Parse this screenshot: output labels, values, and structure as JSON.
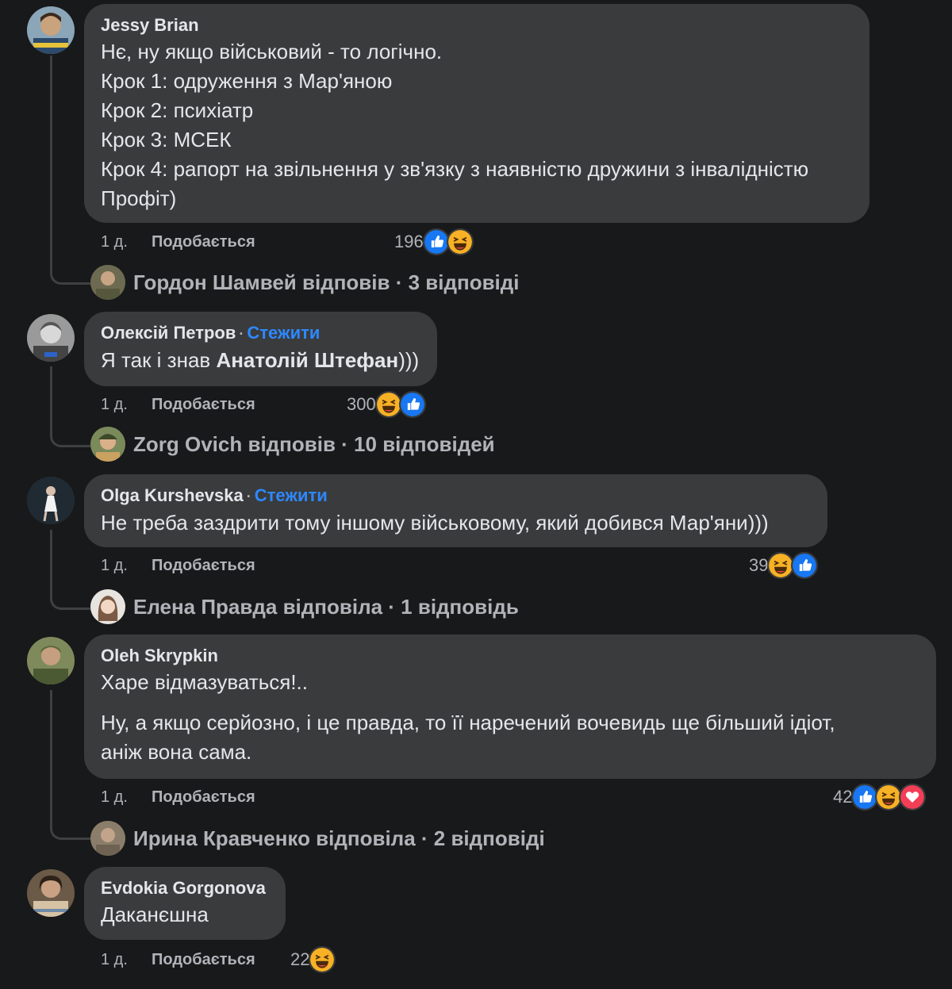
{
  "comments": [
    {
      "author": "Jessy Brian",
      "follow": "",
      "lines": [
        "Нє, ну якщо військовий - то логічно.",
        "Крок 1: одруження з Мар'яною",
        "Крок 2: психіатр",
        "Крок 3: МСЕК",
        "Крок 4: рапорт на звільнення у зв'язку з наявністю дружини з інвалідністю",
        "Профіт)"
      ],
      "time": "1 д.",
      "like_label": "Подобається",
      "reaction_count": "196",
      "reactions": [
        "like-icon",
        "haha-icon"
      ],
      "replies_text": "Гордон Шамвей відповів · 3 відповіді"
    },
    {
      "author": "Олексій Петров",
      "follow": "Стежити",
      "line_prefix": "Я так і знав ",
      "line_bold": "Анатолій Штефан",
      "line_suffix": ")))",
      "time": "1 д.",
      "like_label": "Подобається",
      "reaction_count": "300",
      "reactions": [
        "haha-icon",
        "like-icon"
      ],
      "replies_text": "Zorg Ovich відповів · 10 відповідей"
    },
    {
      "author": "Olga Kurshevska",
      "follow": "Стежити",
      "lines": [
        "Не треба заздрити тому іншому військовому, який добився Мар'яни)))"
      ],
      "time": "1 д.",
      "like_label": "Подобається",
      "reaction_count": "39",
      "reactions": [
        "haha-icon",
        "like-icon"
      ],
      "replies_text": "Елена Правда відповіла · 1 відповідь"
    },
    {
      "author": "Oleh Skrypkin",
      "follow": "",
      "lines": [
        "Харе відмазуваться!..",
        "Ну, а якщо серйозно, і це правда, то її наречений вочевидь ще більший ідіот,",
        "аніж вона сама."
      ],
      "time": "1 д.",
      "like_label": "Подобається",
      "reaction_count": "42",
      "reactions": [
        "like-icon",
        "haha-icon",
        "love-icon"
      ],
      "replies_text": "Ирина Кравченко відповіла · 2 відповіді"
    },
    {
      "author": "Evdokia Gorgonova",
      "follow": "",
      "lines": [
        "Даканєшна"
      ],
      "time": "1 д.",
      "like_label": "Подобається",
      "reaction_count": "22",
      "reactions": [
        "haha-icon"
      ]
    }
  ],
  "colors": {
    "background": "#18191a",
    "bubble": "#3a3b3c",
    "link": "#2d88ff",
    "secondary_text": "#b0b3b8"
  }
}
